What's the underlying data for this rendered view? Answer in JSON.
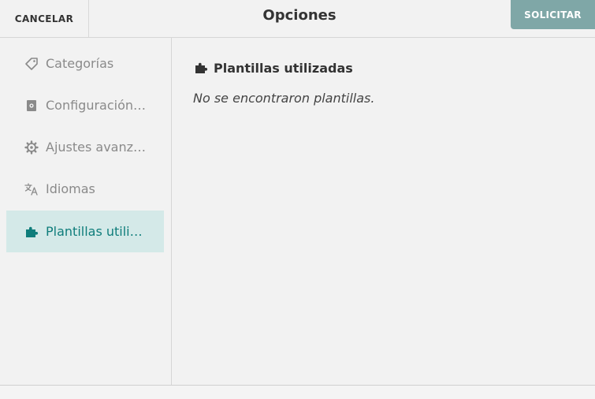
{
  "header": {
    "cancel_label": "CANCELAR",
    "title": "Opciones",
    "submit_label": "SOLICITAR"
  },
  "sidebar": {
    "items": [
      {
        "label": "Categorías",
        "icon": "tag-icon",
        "active": false
      },
      {
        "label": "Configuración…",
        "icon": "settings-file-icon",
        "active": false
      },
      {
        "label": "Ajustes avanz…",
        "icon": "gear-icon",
        "active": false
      },
      {
        "label": "Idiomas",
        "icon": "translate-icon",
        "active": false
      },
      {
        "label": "Plantillas utili…",
        "icon": "puzzle-icon",
        "active": true
      }
    ]
  },
  "main": {
    "section_title": "Plantillas utilizadas",
    "section_icon": "puzzle-icon",
    "empty_message": "No se encontraron plantillas."
  },
  "colors": {
    "accent": "#0f7d7b",
    "active_bg": "#d4e9e8",
    "submit_bg": "#7fa7a7",
    "muted_text": "#8a8a8a"
  }
}
